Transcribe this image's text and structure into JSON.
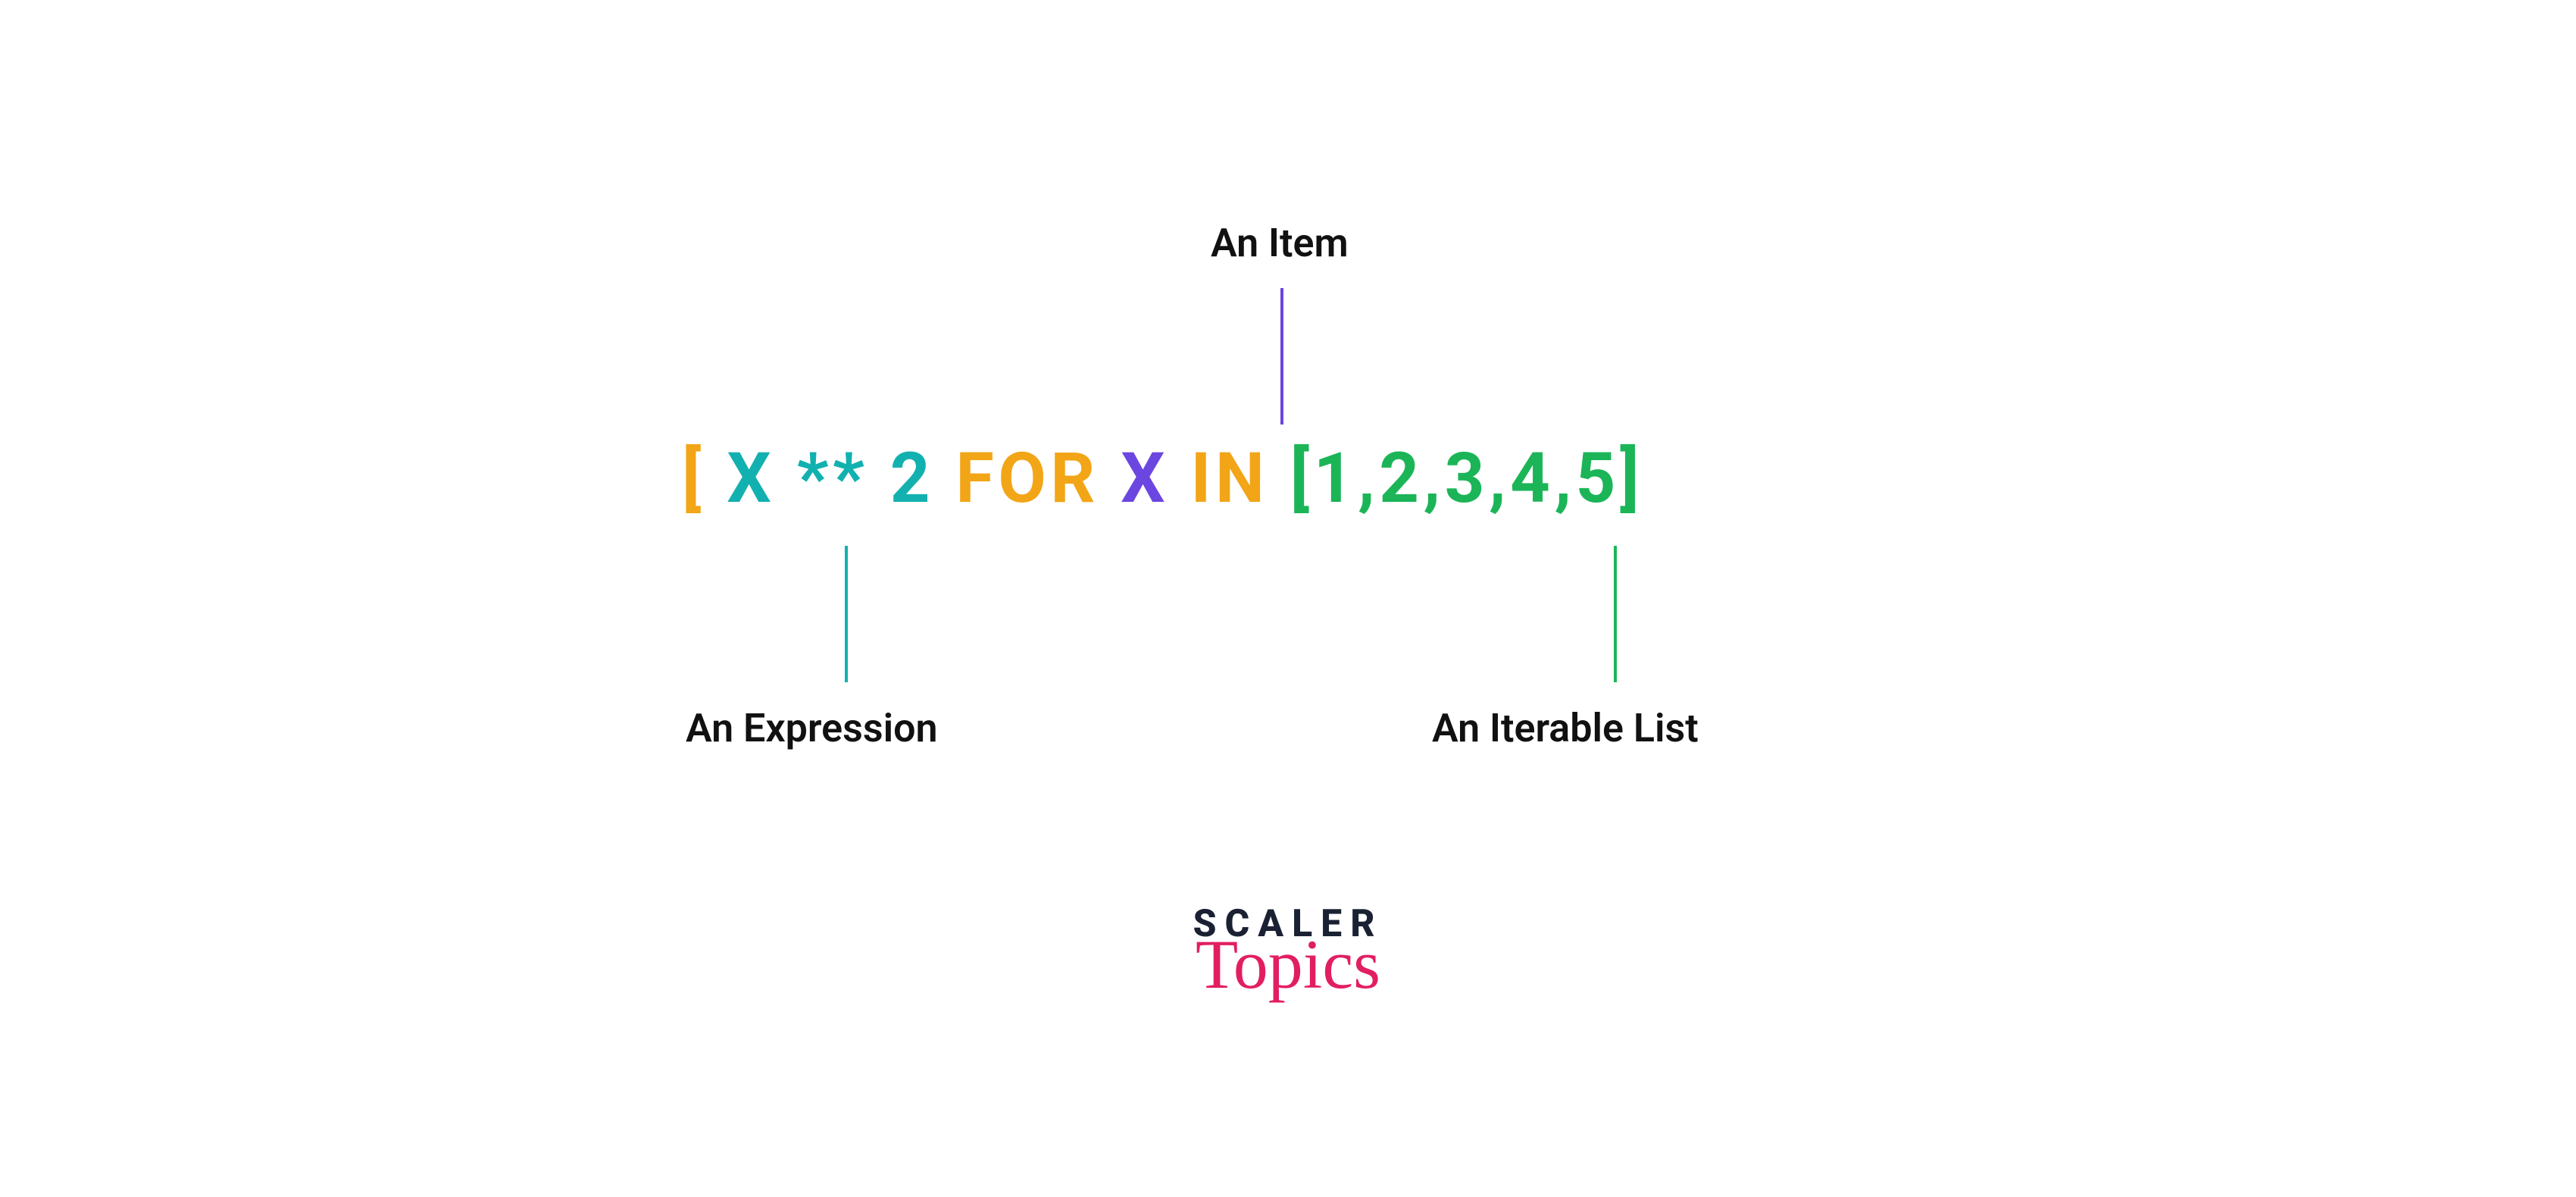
{
  "labels": {
    "item": "An Item",
    "expression": "An Expression",
    "iterable": "An Iterable List"
  },
  "code": {
    "open_bracket": "[",
    "expr_x": "X",
    "expr_op": "**",
    "expr_num": "2",
    "kw_for": "FOR",
    "item_x": "X",
    "kw_in": "IN",
    "iterable": "[1,2,3,4,5]"
  },
  "logo": {
    "line1": "SCALER",
    "line2": "Topics"
  },
  "colors": {
    "orange": "#f2a516",
    "teal": "#12b1b0",
    "purple": "#6b46e0",
    "green": "#1bb558",
    "pink": "#e21e63",
    "dark": "#1a2133"
  }
}
